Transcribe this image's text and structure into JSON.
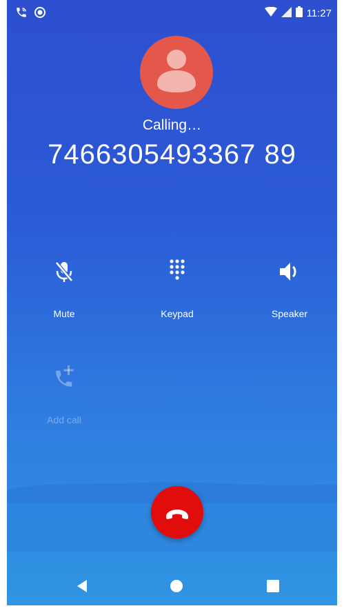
{
  "status_bar": {
    "time": "11:27",
    "left_icons": [
      "wifi-call-icon",
      "record-dot-icon"
    ],
    "right_icons": [
      "wifi-icon",
      "cell-signal-icon",
      "battery-icon"
    ]
  },
  "call": {
    "status": "Calling…",
    "number": "7466305493367 89"
  },
  "controls": {
    "mute_label": "Mute",
    "keypad_label": "Keypad",
    "speaker_label": "Speaker",
    "add_call_label": "Add call"
  },
  "colors": {
    "avatar": "#e4584b",
    "end_call": "#e10c0c",
    "background_top": "#2d4fd0",
    "background_bottom": "#2f95e3"
  },
  "nav": {
    "buttons": [
      "back-icon",
      "home-icon",
      "recents-icon"
    ]
  }
}
